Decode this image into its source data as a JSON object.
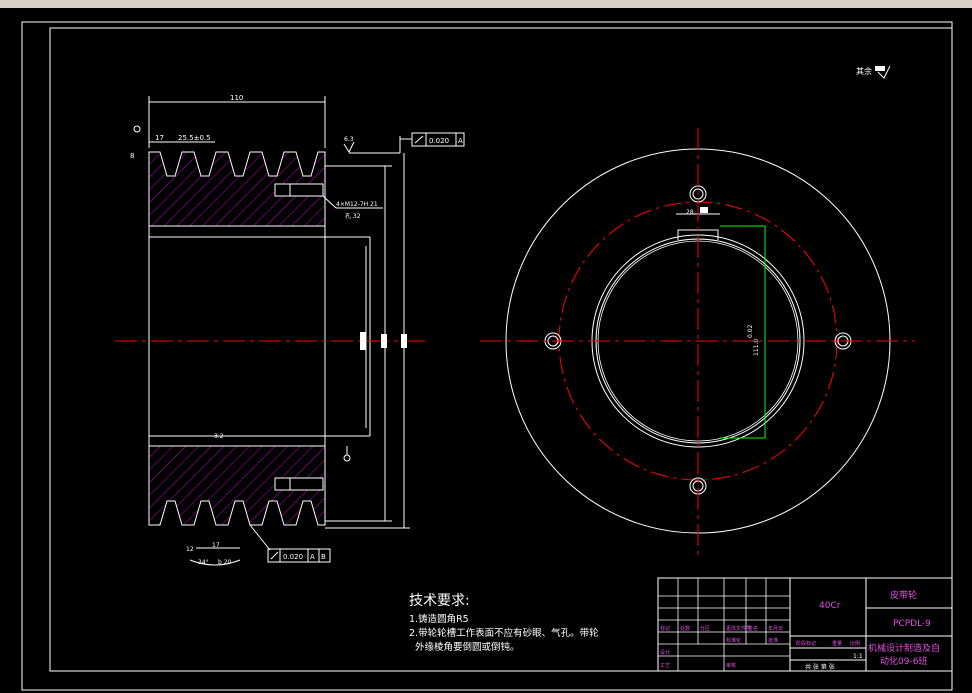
{
  "colors": {
    "background": "#000000",
    "outline": "#ffffff",
    "centerline": "#ff0000",
    "hatch": "#c000c0",
    "dimension": "#ffffff",
    "highlight_dim": "#00ff00",
    "title_text": "#ff00ff",
    "menu_bar": "#d4d0c8"
  },
  "corner_note": {
    "text": "其余"
  },
  "section_view": {
    "dim_width": "110",
    "dim_groove_first": "17",
    "dim_groove_pitch": "25.5±0.5",
    "dim_depth_top": "8",
    "roughness_top": "6.3",
    "tolerance_top": {
      "value": "0.020",
      "datum": "A"
    },
    "thread_note_line1": "4×M12-7H 21",
    "thread_note_line2": "孔 32",
    "roughness_bore": "3.2",
    "dim_bottom_groove": "17",
    "dim_bottom_edge": "12",
    "dim_groove_angle": "34°",
    "dim_groove_width": "b 20",
    "tolerance_bottom": {
      "value": "0.020",
      "datum_a": "A",
      "datum_b": "B"
    },
    "datum_a_label": "A",
    "datum_b_label": "B"
  },
  "end_view": {
    "keyway_width": "28",
    "keyway_depth_1": "111.0",
    "keyway_depth_2": "0.02"
  },
  "technical_requirements": {
    "title": "技术要求:",
    "items": [
      "1.铸造圆角R5",
      "2.带轮轮槽工作表面不应有砂眼、气孔。带轮",
      "  外缘棱角要倒圆或倒钝。"
    ]
  },
  "title_block": {
    "material": "40Cr",
    "part_name": "皮带轮",
    "drawing_no": "PCPDL-9",
    "school_line1": "机械设计制造及自",
    "school_line2": "动化09-6班",
    "scale": "1:1",
    "sheet_info": "共 张  第 张",
    "row_labels": [
      "标记",
      "处数",
      "分区",
      "更改文件号",
      "签名",
      "年月日"
    ],
    "row_labels_2": [
      "设计",
      "标准化",
      "审核",
      "工艺",
      "批准"
    ],
    "stage_labels": [
      "阶段标记",
      "重量",
      "比例"
    ]
  }
}
